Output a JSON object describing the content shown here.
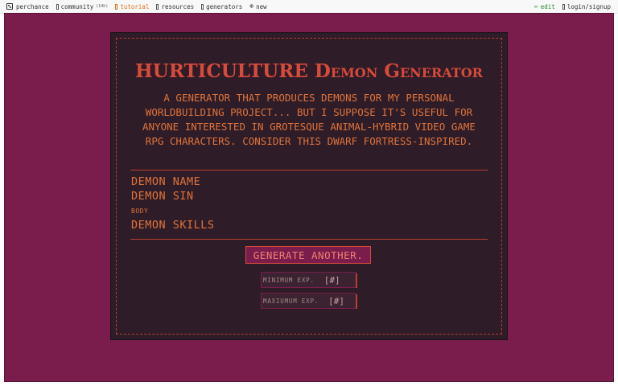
{
  "nav": {
    "site_name": "perchance",
    "community_label": "community",
    "community_count": "(14h)",
    "tutorial_label": "tutorial",
    "resources_label": "resources",
    "generators_label": "generators",
    "new_label": "new",
    "edit_label": "edit",
    "login_label": "login/signup"
  },
  "generator": {
    "title_caps": "HURTICULTURE",
    "title_rest": "Demon Generator",
    "description": "A generator that produces demons for my personal worldbuilding project... but I suppose it's useful for anyone interested in grotesque animal-hybrid video game RPG characters. Consider this Dwarf Fortress-inspired."
  },
  "output": {
    "demon_name": "DEMON NAME",
    "demon_sin": "DEMON SIN",
    "body_label": "BODY",
    "demon_skills": "DEMON SKILLS"
  },
  "controls": {
    "generate_label": "GENERATE ANOTHER.",
    "min_label": "MINIMUM EXP.",
    "min_value": "[#]",
    "max_label": "MAXIUMUM EXP.",
    "max_value": "[#]"
  },
  "colors": {
    "background": "#7a1d4d",
    "panel": "#2e1c28",
    "accent": "#d84a3a",
    "text": "#e0733a"
  }
}
